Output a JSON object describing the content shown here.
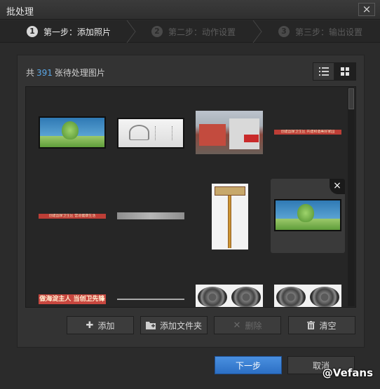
{
  "window": {
    "title": "批处理",
    "close_glyph": "×"
  },
  "steps": [
    {
      "num": "1",
      "label": "第一步：添加照片",
      "state": "active"
    },
    {
      "num": "2",
      "label": "第二步：动作设置",
      "state": "inactive"
    },
    {
      "num": "3",
      "label": "第三步：输出设置",
      "state": "inactive"
    }
  ],
  "summary": {
    "prefix": "共",
    "count": "391",
    "suffix": "张待处理图片"
  },
  "view_toggle": {
    "list_icon": "list-icon",
    "grid_icon": "grid-icon",
    "selected": "grid"
  },
  "thumbnails": {
    "row3_banner_text": "做海淀主人 当创卫先锋",
    "row2_banner_text": "创建国家卫生区 营造健康生活",
    "row1_strip_text": "创建国家卫生区 共建和谐美好家园"
  },
  "actions": {
    "add": "添加",
    "add_folder": "添加文件夹",
    "delete": "删除",
    "clear": "清空"
  },
  "footer": {
    "next": "下一步",
    "cancel": "取消"
  },
  "watermark": "@Vefans",
  "colors": {
    "accent_blue": "#5aa7e6",
    "primary_button": "#2c6fc4"
  }
}
